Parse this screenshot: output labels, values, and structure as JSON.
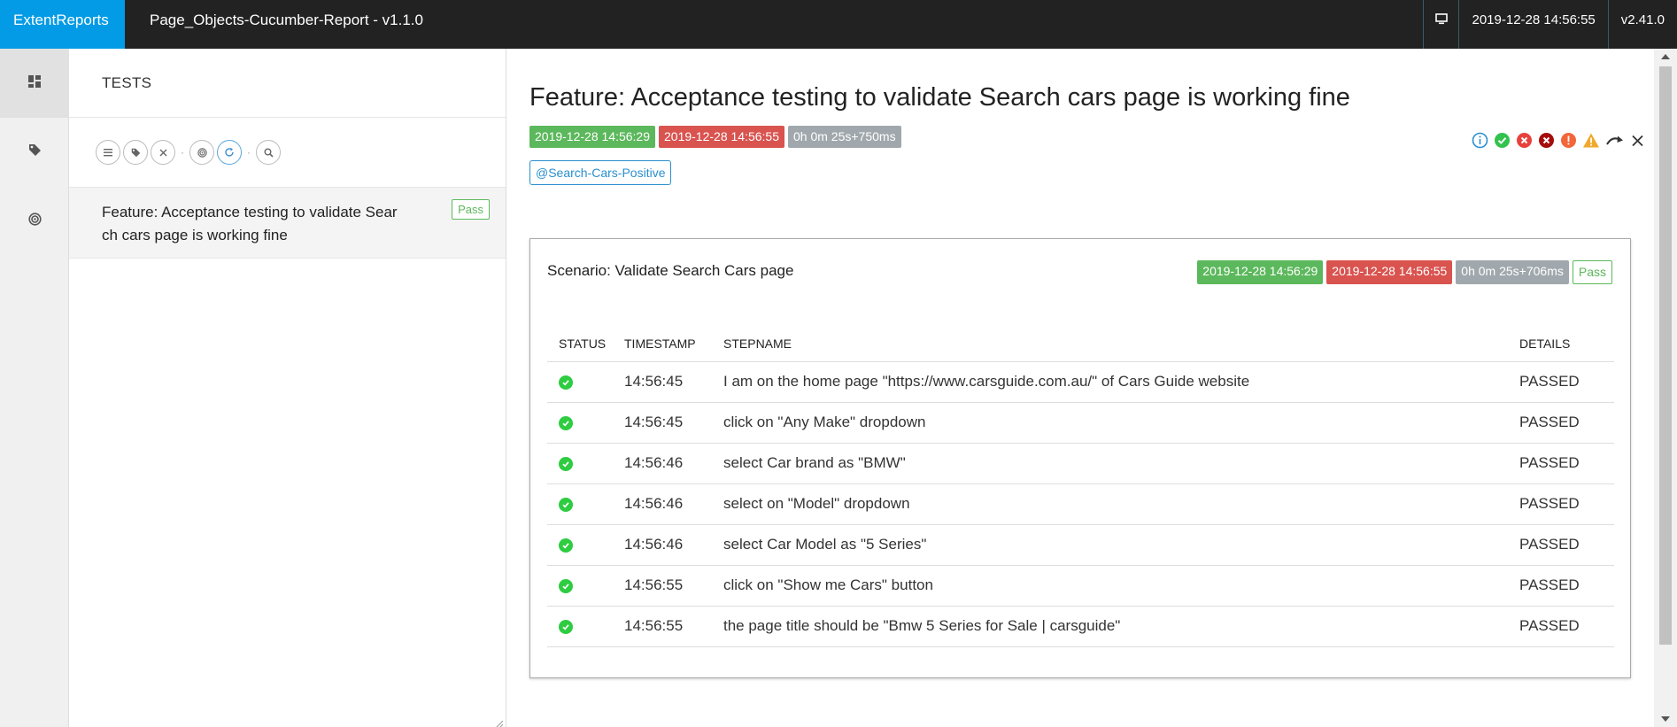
{
  "header": {
    "brand": "ExtentReports",
    "report_name": "Page_Objects-Cucumber-Report - v1.1.0",
    "timestamp": "2019-12-28 14:56:55",
    "version": "v2.41.0",
    "monitor_icon": "monitor-icon"
  },
  "rail": {
    "items": [
      {
        "icon": "dashboard-icon"
      },
      {
        "icon": "tag-icon"
      },
      {
        "icon": "exceptions-icon"
      }
    ]
  },
  "list": {
    "heading": "TESTS",
    "filters": [
      "status-filter-icon",
      "tag-filter-icon",
      "clear-filter-icon",
      "exceptions-filter-icon",
      "refresh-icon",
      "search-icon"
    ],
    "tests": [
      {
        "name": "Feature: Acceptance testing to validate Search cars page is working fine",
        "status": "Pass"
      }
    ]
  },
  "feature": {
    "title": "Feature: Acceptance testing to validate Search cars page is working fine",
    "start": "2019-12-28 14:56:29",
    "end": "2019-12-28 14:56:55",
    "duration": "0h 0m 25s+750ms",
    "tag": "@Search-Cars-Positive"
  },
  "scenario": {
    "title": "Scenario: Validate Search Cars page",
    "start": "2019-12-28 14:56:29",
    "end": "2019-12-28 14:56:55",
    "duration": "0h 0m 25s+706ms",
    "status": "Pass",
    "columns": {
      "status": "STATUS",
      "timestamp": "TIMESTAMP",
      "stepname": "STEPNAME",
      "details": "DETAILS"
    },
    "steps": [
      {
        "time": "14:56:45",
        "name": "I am on the home page \"https://www.carsguide.com.au/\" of Cars Guide website",
        "details": "PASSED"
      },
      {
        "time": "14:56:45",
        "name": "click on \"Any Make\" dropdown",
        "details": "PASSED"
      },
      {
        "time": "14:56:46",
        "name": "select Car brand as \"BMW\"",
        "details": "PASSED"
      },
      {
        "time": "14:56:46",
        "name": "select on \"Model\" dropdown",
        "details": "PASSED"
      },
      {
        "time": "14:56:46",
        "name": "select Car Model as \"5 Series\"",
        "details": "PASSED"
      },
      {
        "time": "14:56:55",
        "name": "click on \"Show me Cars\" button",
        "details": "PASSED"
      },
      {
        "time": "14:56:55",
        "name": "the page title should be \"Bmw 5 Series for Sale | carsguide\"",
        "details": "PASSED"
      }
    ]
  },
  "colors": {
    "brand": "#039be5",
    "topbar": "#222222",
    "pass": "#5cb85c",
    "fail": "#d9534f",
    "duration": "#a0a8ad"
  }
}
